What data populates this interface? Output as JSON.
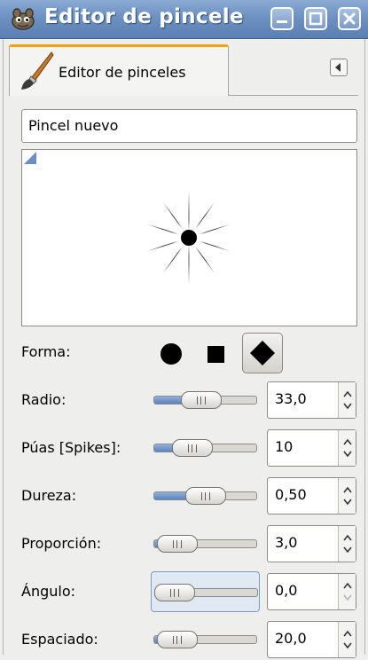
{
  "window": {
    "title": "Editor de pincele"
  },
  "tab": {
    "label": "Editor de pinceles"
  },
  "brush": {
    "name": "Pincel nuevo"
  },
  "shape": {
    "label": "Forma:",
    "options": [
      "circle",
      "square",
      "diamond"
    ],
    "selected": "diamond"
  },
  "params": [
    {
      "label": "Radio:",
      "value": "33,0",
      "level": 0.44
    },
    {
      "label": "Púas [Spikes]:",
      "value": "10",
      "level": 0.3
    },
    {
      "label": "Dureza:",
      "value": "0,50",
      "level": 0.5
    },
    {
      "label": "Proporción:",
      "value": "3,0",
      "level": 0.05
    },
    {
      "label": "Ángulo:",
      "value": "0,0",
      "level": 0.0
    },
    {
      "label": "Espaciado:",
      "value": "20,0",
      "level": 0.05
    }
  ],
  "colors": {
    "titlebar": "#6d91c2",
    "slider_fill": "#5b84c0",
    "tab_accent": "#f4a400"
  }
}
